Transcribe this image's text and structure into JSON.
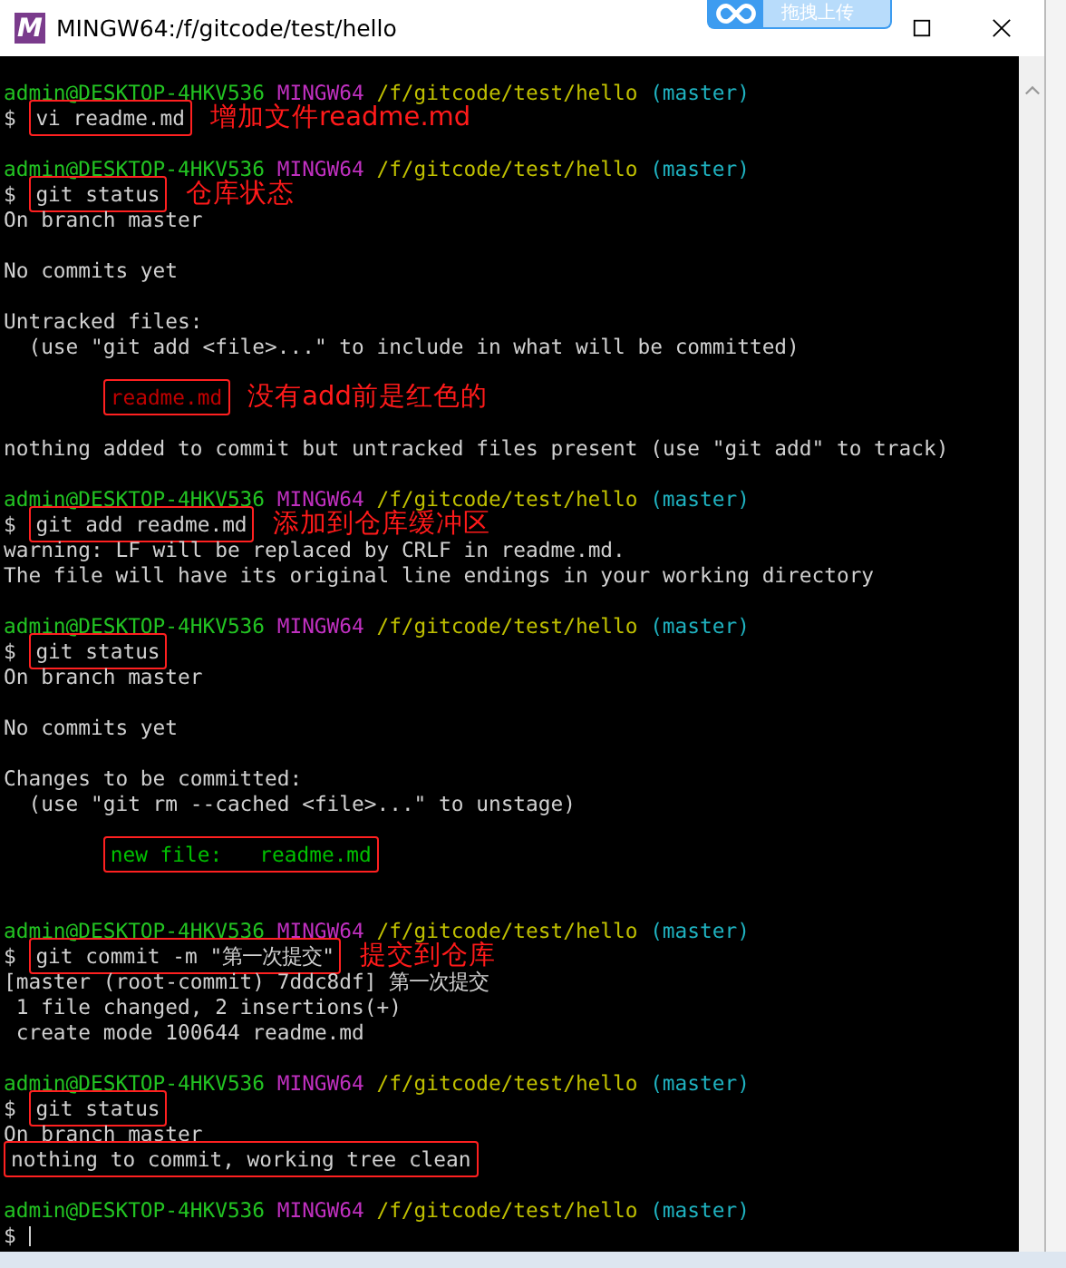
{
  "window": {
    "icon": "M",
    "title": "MINGW64:/f/gitcode/test/hello"
  },
  "upload_widget": {
    "label": "拖拽上传"
  },
  "lines": [
    {
      "kind": "prompt",
      "user": "admin@DESKTOP-4HKV536",
      "system": "MINGW64",
      "path": "/f/gitcode/test/hello",
      "branch": "(master)"
    },
    {
      "kind": "command",
      "prompt": "$",
      "text": "vi readme.md",
      "boxed": true,
      "note": "增加文件readme.md"
    },
    {
      "kind": "blank"
    },
    {
      "kind": "prompt",
      "user": "admin@DESKTOP-4HKV536",
      "system": "MINGW64",
      "path": "/f/gitcode/test/hello",
      "branch": "(master)"
    },
    {
      "kind": "command",
      "prompt": "$",
      "text": "git status",
      "boxed": true,
      "note": "仓库状态"
    },
    {
      "kind": "output",
      "text": "On branch master"
    },
    {
      "kind": "blank"
    },
    {
      "kind": "output",
      "text": "No commits yet"
    },
    {
      "kind": "blank"
    },
    {
      "kind": "output",
      "text": "Untracked files:"
    },
    {
      "kind": "output",
      "text": "  (use \"git add <file>...\" to include in what will be committed)"
    },
    {
      "kind": "blank"
    },
    {
      "kind": "output",
      "text": "        readme.md",
      "color": "#c00000",
      "boxed": true,
      "note": "没有add前是红色的"
    },
    {
      "kind": "blank"
    },
    {
      "kind": "output",
      "text": "nothing added to commit but untracked files present (use \"git add\" to track)"
    },
    {
      "kind": "blank"
    },
    {
      "kind": "prompt",
      "user": "admin@DESKTOP-4HKV536",
      "system": "MINGW64",
      "path": "/f/gitcode/test/hello",
      "branch": "(master)"
    },
    {
      "kind": "command",
      "prompt": "$",
      "text": "git add readme.md",
      "boxed": true,
      "note": "添加到仓库缓冲区"
    },
    {
      "kind": "output",
      "text": "warning: LF will be replaced by CRLF in readme.md."
    },
    {
      "kind": "output",
      "text": "The file will have its original line endings in your working directory"
    },
    {
      "kind": "blank"
    },
    {
      "kind": "prompt",
      "user": "admin@DESKTOP-4HKV536",
      "system": "MINGW64",
      "path": "/f/gitcode/test/hello",
      "branch": "(master)"
    },
    {
      "kind": "command",
      "prompt": "$",
      "text": "git status",
      "boxed": true
    },
    {
      "kind": "output",
      "text": "On branch master"
    },
    {
      "kind": "blank"
    },
    {
      "kind": "output",
      "text": "No commits yet"
    },
    {
      "kind": "blank"
    },
    {
      "kind": "output",
      "text": "Changes to be committed:"
    },
    {
      "kind": "output",
      "text": "  (use \"git rm --cached <file>...\" to unstage)"
    },
    {
      "kind": "blank"
    },
    {
      "kind": "output",
      "text": "        new file:   readme.md",
      "color": "#00c000",
      "boxed": true
    },
    {
      "kind": "blank"
    },
    {
      "kind": "blank"
    },
    {
      "kind": "prompt",
      "user": "admin@DESKTOP-4HKV536",
      "system": "MINGW64",
      "path": "/f/gitcode/test/hello",
      "branch": "(master)"
    },
    {
      "kind": "command",
      "prompt": "$",
      "text": "git commit -m \"第一次提交\"",
      "boxed": true,
      "note": "提交到仓库"
    },
    {
      "kind": "output",
      "text": "[master (root-commit) 7ddc8df] 第一次提交"
    },
    {
      "kind": "output",
      "text": " 1 file changed, 2 insertions(+)"
    },
    {
      "kind": "output",
      "text": " create mode 100644 readme.md"
    },
    {
      "kind": "blank"
    },
    {
      "kind": "prompt",
      "user": "admin@DESKTOP-4HKV536",
      "system": "MINGW64",
      "path": "/f/gitcode/test/hello",
      "branch": "(master)"
    },
    {
      "kind": "command",
      "prompt": "$",
      "text": "git status",
      "boxed": true
    },
    {
      "kind": "output",
      "text": "On branch master"
    },
    {
      "kind": "output",
      "text": "nothing to commit, working tree clean",
      "boxed": true
    },
    {
      "kind": "blank"
    },
    {
      "kind": "prompt",
      "user": "admin@DESKTOP-4HKV536",
      "system": "MINGW64",
      "path": "/f/gitcode/test/hello",
      "branch": "(master)"
    },
    {
      "kind": "command",
      "prompt": "$",
      "cursor": true
    }
  ]
}
